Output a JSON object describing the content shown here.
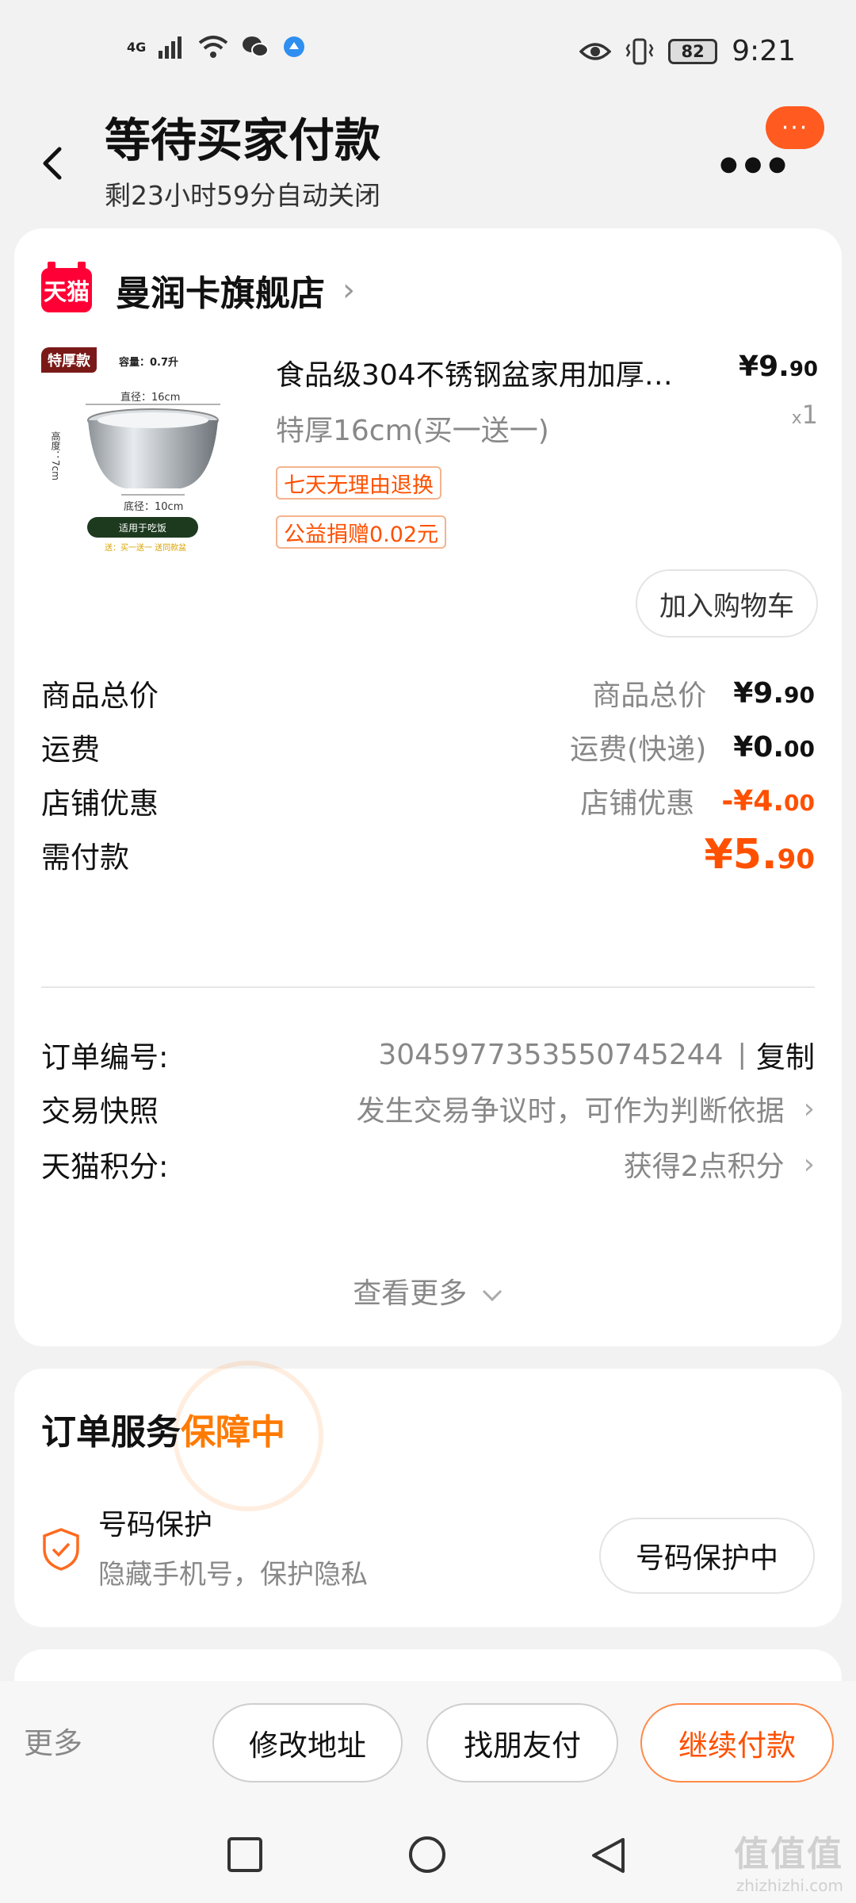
{
  "status_bar": {
    "network": "4G",
    "battery": "82",
    "time": "9:21"
  },
  "header": {
    "title": "等待买家付款",
    "subtitle": "剩23小时59分自动关闭",
    "more_label": "···"
  },
  "shop": {
    "logo_text": "天猫",
    "name": "曼润卡旗舰店"
  },
  "product": {
    "image": {
      "tag": "特厚款",
      "capacity": "容量：0.7升",
      "top_diameter": "直径：16cm",
      "height": "高度：7cm",
      "bottom_diameter": "底径：10cm",
      "usage": "适用于吃饭",
      "note": "送：买一送一 送同款盆"
    },
    "title": "食品级304不锈钢盆家用加厚…",
    "price_main": "¥9.",
    "price_decimal": "90",
    "spec": "特厚16cm(买一送一)",
    "qty_prefix": "x",
    "qty": "1",
    "tags": [
      "七天无理由退换",
      "公益捐赠0.02元"
    ],
    "add_to_cart": "加入购物车"
  },
  "fees": [
    {
      "label": "商品总价",
      "hint": "商品总价",
      "main": "¥9.",
      "decimal": "90"
    },
    {
      "label": "运费",
      "hint": "运费(快递)",
      "main": "¥0.",
      "decimal": "00"
    },
    {
      "label": "店铺优惠",
      "hint": "店铺优惠",
      "main": "-¥4.",
      "decimal": "00"
    },
    {
      "label": "需付款",
      "hint": "",
      "main": "¥5.",
      "decimal": "90"
    }
  ],
  "order_info": {
    "order_no_label": "订单编号:",
    "order_no": "3045977353550745244",
    "separator": "|",
    "copy": "复制",
    "snapshot_label": "交易快照",
    "snapshot_value": "发生交易争议时，可作为判断依据",
    "points_label": "天猫积分:",
    "points_value": "获得2点积分",
    "see_more": "查看更多"
  },
  "service": {
    "title": "订单服务",
    "title_highlight": "保障中",
    "item_name": "号码保护",
    "item_desc": "隐藏手机号，保护隐私",
    "item_button": "号码保护中"
  },
  "actions": {
    "more": "更多",
    "change_address": "修改地址",
    "friend_pay": "找朋友付",
    "continue_pay": "继续付款"
  },
  "watermark": {
    "line1": "值值值",
    "line2": "zhizhizhi.com"
  },
  "colors": {
    "accent": "#ff5000",
    "tmall_red": "#ff0036",
    "highlight": "#ff7a00"
  }
}
